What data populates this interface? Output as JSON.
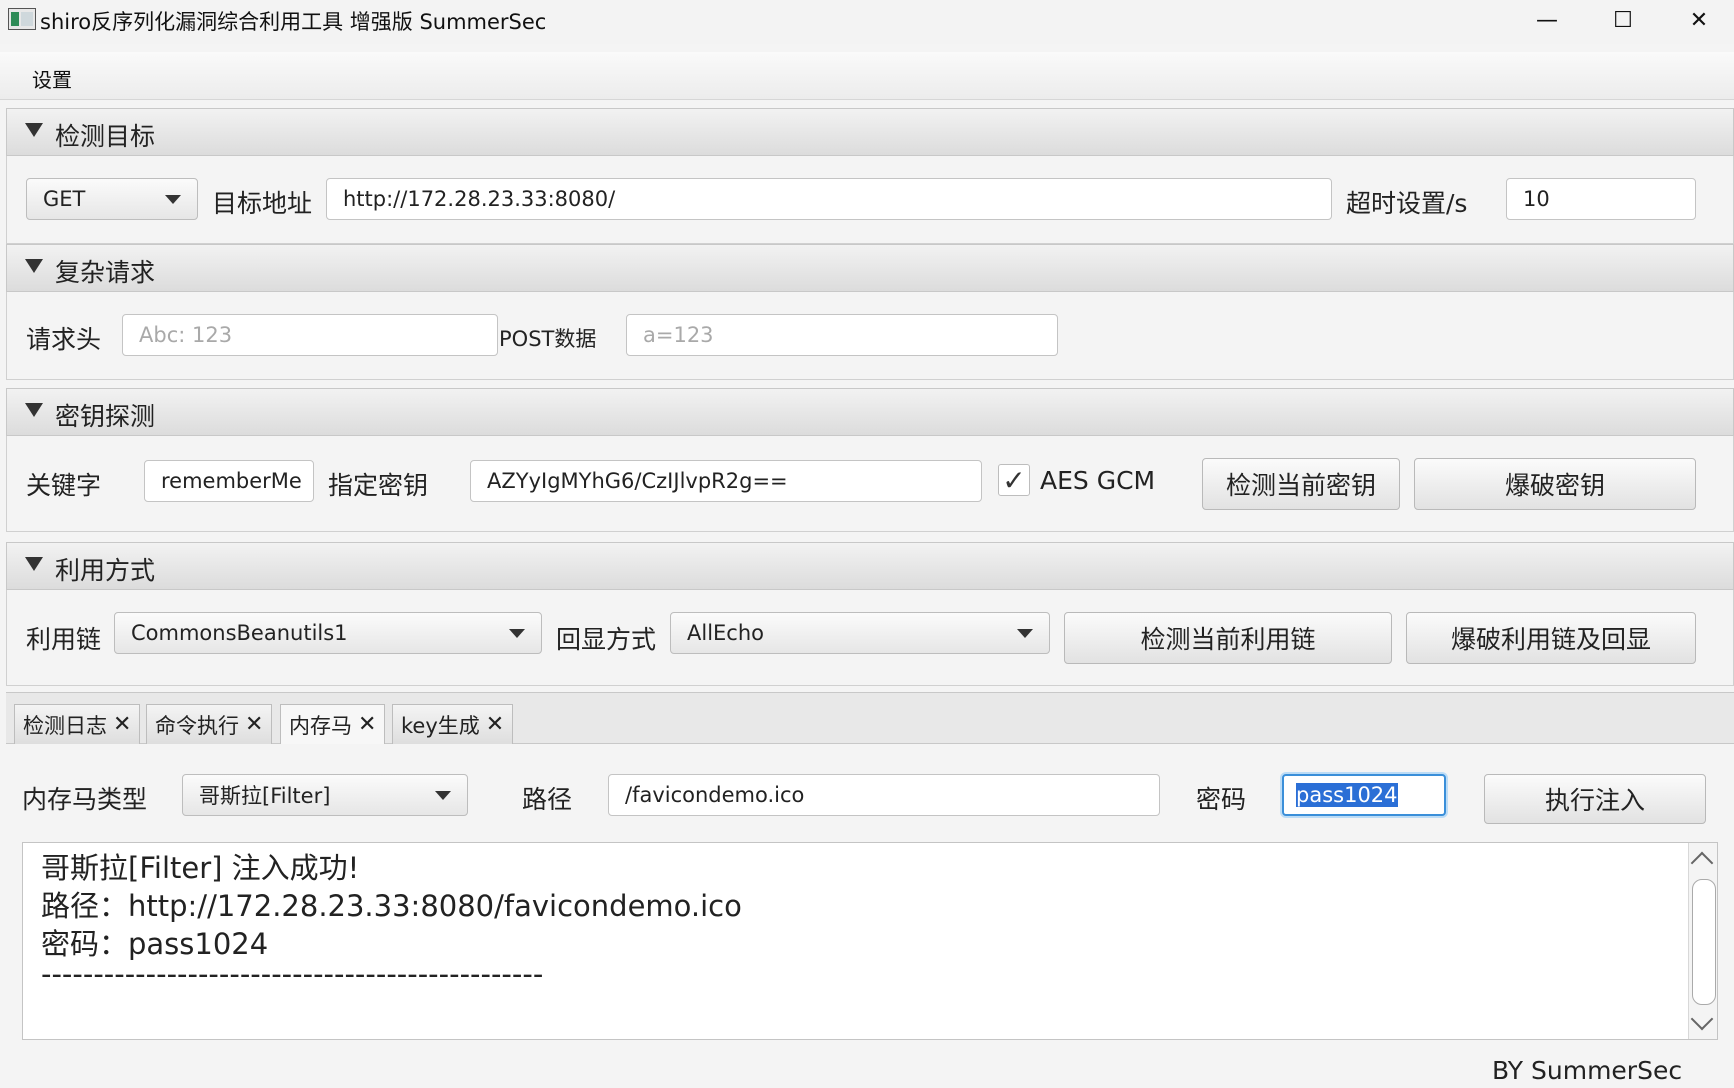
{
  "window": {
    "title": "shiro反序列化漏洞综合利用工具 增强版 SummerSec",
    "minimize_glyph": "—",
    "maximize_glyph": "☐",
    "close_glyph": "✕"
  },
  "menu": {
    "settings": "设置"
  },
  "target_section": {
    "title": "检测目标",
    "method": "GET",
    "url_label": "目标地址",
    "url_value": "http://172.28.23.33:8080/",
    "timeout_label": "超时设置/s",
    "timeout_value": "10"
  },
  "complex_section": {
    "title": "复杂请求",
    "header_label": "请求头",
    "header_placeholder": "Abc: 123",
    "post_label": "POST数据",
    "post_placeholder": "a=123"
  },
  "key_section": {
    "title": "密钥探测",
    "keyword_label": "关键字",
    "keyword_value": "rememberMe",
    "key_label": "指定密钥",
    "key_value": "AZYyIgMYhG6/CzIJlvpR2g==",
    "aes_gcm_checked": true,
    "aes_gcm_label": "AES GCM",
    "check_key_button": "检测当前密钥",
    "brute_key_button": "爆破密钥"
  },
  "exploit_section": {
    "title": "利用方式",
    "chain_label": "利用链",
    "chain_value": "CommonsBeanutils1",
    "echo_label": "回显方式",
    "echo_value": "AllEcho",
    "check_chain_button": "检测当前利用链",
    "brute_chain_button": "爆破利用链及回显"
  },
  "tabs": [
    {
      "label": "检测日志",
      "active": false
    },
    {
      "label": "命令执行",
      "active": false
    },
    {
      "label": "内存马",
      "active": true
    },
    {
      "label": "key生成",
      "active": false
    }
  ],
  "memshell": {
    "type_label": "内存马类型",
    "type_value": "哥斯拉[Filter]",
    "path_label": "路径",
    "path_value": "/favicondemo.ico",
    "password_label": "密码",
    "password_value": "pass1024",
    "inject_button": "执行注入"
  },
  "output": {
    "lines": [
      "哥斯拉[Filter]  注入成功!",
      "路径：http://172.28.23.33:8080/favicondemo.ico",
      "密码：pass1024",
      "------------------------------------------------"
    ]
  },
  "footer": {
    "credit": "BY   SummerSec"
  }
}
